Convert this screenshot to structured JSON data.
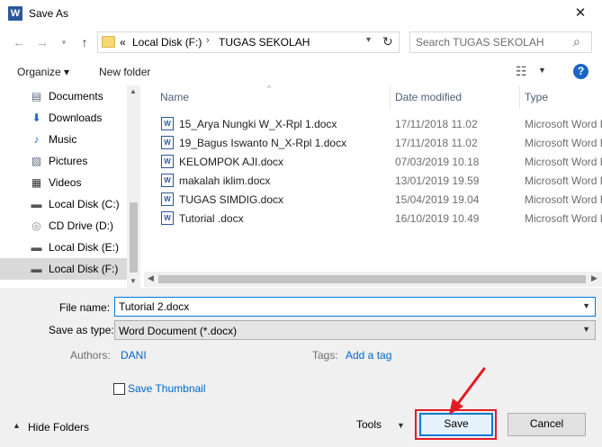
{
  "window": {
    "title": "Save As",
    "app_icon_letter": "W",
    "close_glyph": "✕"
  },
  "address": {
    "overflow": "«",
    "parts": [
      "Local Disk (F:)",
      "TUGAS SEKOLAH"
    ],
    "separator": "›"
  },
  "search": {
    "placeholder": "Search TUGAS SEKOLAH"
  },
  "toolbar": {
    "organize": "Organize ▾",
    "new_folder": "New folder",
    "help": "?"
  },
  "nav": {
    "items": [
      {
        "label": "Documents",
        "icon": "document-icon",
        "glyph": "▤",
        "color": "#5a6b7f"
      },
      {
        "label": "Downloads",
        "icon": "download-icon",
        "glyph": "⬇",
        "color": "#1a64c8"
      },
      {
        "label": "Music",
        "icon": "music-icon",
        "glyph": "♪",
        "color": "#1a64c8"
      },
      {
        "label": "Pictures",
        "icon": "pictures-icon",
        "glyph": "▨",
        "color": "#5a6b7f"
      },
      {
        "label": "Videos",
        "icon": "video-icon",
        "glyph": "▦",
        "color": "#333333"
      },
      {
        "label": "Local Disk (C:)",
        "icon": "windows-drive-icon",
        "glyph": "▬",
        "color": "#555555"
      },
      {
        "label": "CD Drive (D:)",
        "icon": "cd-drive-icon",
        "glyph": "◎",
        "color": "#8a8a8a"
      },
      {
        "label": "Local Disk (E:)",
        "icon": "drive-icon",
        "glyph": "▬",
        "color": "#555555"
      },
      {
        "label": "Local Disk (F:)",
        "icon": "drive-icon",
        "glyph": "▬",
        "color": "#555555",
        "selected": true
      }
    ]
  },
  "files": {
    "columns": {
      "name": "Name",
      "date": "Date modified",
      "type": "Type"
    },
    "rows": [
      {
        "name": "15_Arya Nungki W_X-Rpl 1.docx",
        "date": "17/11/2018 11.02",
        "type": "Microsoft Word D"
      },
      {
        "name": "19_Bagus Iswanto N_X-Rpl 1.docx",
        "date": "17/11/2018 11.02",
        "type": "Microsoft Word D"
      },
      {
        "name": "KELOMPOK AJI.docx",
        "date": "07/03/2019 10.18",
        "type": "Microsoft Word D"
      },
      {
        "name": "makalah iklim.docx",
        "date": "13/01/2019 19.59",
        "type": "Microsoft Word D"
      },
      {
        "name": "TUGAS SIMDIG.docx",
        "date": "15/04/2019 19.04",
        "type": "Microsoft Word D"
      },
      {
        "name": "Tutorial .docx",
        "date": "16/10/2019 10.49",
        "type": "Microsoft Word D"
      }
    ]
  },
  "form": {
    "file_name_label": "File name:",
    "file_name_value": "Tutorial 2.docx",
    "save_as_type_label": "Save as type:",
    "save_as_type_value": "Word Document (*.docx)",
    "authors_label": "Authors:",
    "authors_value": "DANI",
    "tags_label": "Tags:",
    "tags_value": "Add a tag",
    "save_thumbnail": "Save Thumbnail"
  },
  "footer": {
    "hide_folders": "Hide Folders",
    "tools": "Tools",
    "save": "Save",
    "cancel": "Cancel"
  },
  "colors": {
    "annotation": "#e21b23",
    "accent": "#0078d7",
    "link": "#0066cc"
  }
}
